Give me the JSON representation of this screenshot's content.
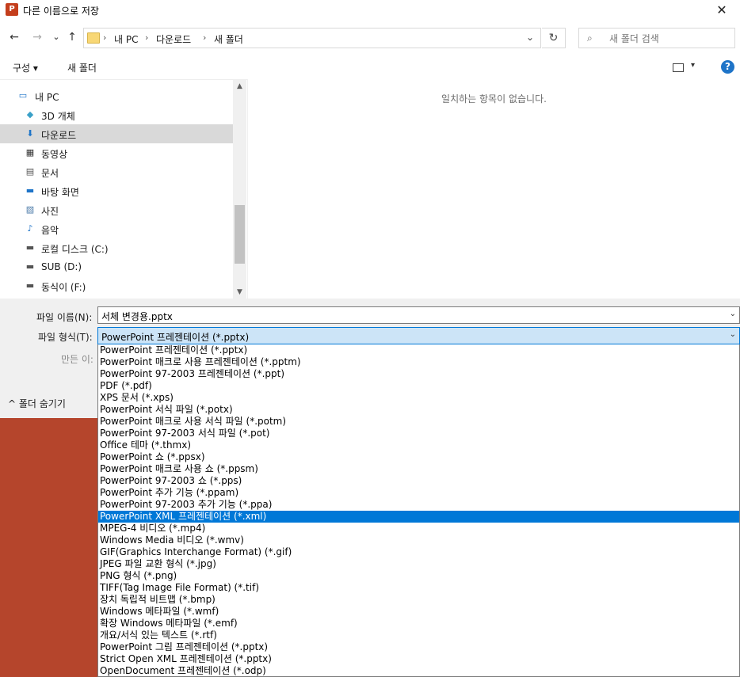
{
  "window": {
    "app_icon": "P",
    "title": "다른 이름으로 저장",
    "close_icon": "✕"
  },
  "nav": {
    "back_icon": "←",
    "forward_icon": "→",
    "recent_icon": "⌄",
    "up_icon": "↑",
    "breadcrumb": [
      "내 PC",
      "다운로드",
      "새 폴더"
    ],
    "separator": "›",
    "address_dropdown_icon": "⌄",
    "refresh_icon": "↻",
    "search_icon": "⌕",
    "search_placeholder": "새 폴더 검색"
  },
  "toolbar": {
    "organize_label": "구성 ▾",
    "new_folder_label": "새 폴더",
    "view_dropdown_icon": "▾",
    "help_icon": "?"
  },
  "tree": {
    "items": [
      {
        "label": "내 PC",
        "icon": "pc-icon",
        "glyph": "▭",
        "color": "#1e74c8"
      },
      {
        "label": "3D 개체",
        "icon": "cube-icon",
        "glyph": "◆",
        "color": "#3aa0c8"
      },
      {
        "label": "다운로드",
        "icon": "download-icon",
        "glyph": "⬇",
        "color": "#1e74c8"
      },
      {
        "label": "동영상",
        "icon": "film-icon",
        "glyph": "▦",
        "color": "#333333"
      },
      {
        "label": "문서",
        "icon": "document-icon",
        "glyph": "▤",
        "color": "#555555"
      },
      {
        "label": "바탕 화면",
        "icon": "desktop-icon",
        "glyph": "▬",
        "color": "#1e74c8"
      },
      {
        "label": "사진",
        "icon": "picture-icon",
        "glyph": "▧",
        "color": "#4a7aa8"
      },
      {
        "label": "음악",
        "icon": "music-icon",
        "glyph": "♪",
        "color": "#1e74c8"
      },
      {
        "label": "로컬 디스크 (C:)",
        "icon": "drive-icon",
        "glyph": "▬",
        "color": "#555555"
      },
      {
        "label": "SUB (D:)",
        "icon": "drive-icon",
        "glyph": "▬",
        "color": "#555555"
      },
      {
        "label": "동식이 (F:)",
        "icon": "drive-icon",
        "glyph": "▬",
        "color": "#555555"
      }
    ],
    "selected_index": 2,
    "scroll_up_icon": "▲",
    "scroll_down_icon": "▼"
  },
  "content": {
    "empty_message": "일치하는 항목이 없습니다."
  },
  "form": {
    "filename_label": "파일 이름(N):",
    "filename_value": "서체 변경용.pptx",
    "filetype_label": "파일 형식(T):",
    "filetype_value": "PowerPoint 프레젠테이션 (*.pptx)",
    "author_label_partial": "만든 이:",
    "dropdown_icon": "⌄",
    "hide_folders_label": "^  폴더 숨기기"
  },
  "filetype_options": [
    "PowerPoint 프레젠테이션 (*.pptx)",
    "PowerPoint 매크로 사용 프레젠테이션 (*.pptm)",
    "PowerPoint 97-2003 프레젠테이션 (*.ppt)",
    "PDF (*.pdf)",
    "XPS 문서 (*.xps)",
    "PowerPoint 서식 파일 (*.potx)",
    "PowerPoint 매크로 사용 서식 파일 (*.potm)",
    "PowerPoint 97-2003 서식 파일 (*.pot)",
    "Office 테마 (*.thmx)",
    "PowerPoint 쇼 (*.ppsx)",
    "PowerPoint 매크로 사용 쇼 (*.ppsm)",
    "PowerPoint 97-2003 쇼 (*.pps)",
    "PowerPoint 추가 기능 (*.ppam)",
    "PowerPoint 97-2003 추가 기능 (*.ppa)",
    "PowerPoint XML 프레젠테이션 (*.xml)",
    "MPEG-4 비디오 (*.mp4)",
    "Windows Media 비디오 (*.wmv)",
    "GIF(Graphics Interchange Format) (*.gif)",
    "JPEG 파일 교환 형식 (*.jpg)",
    "PNG 형식 (*.png)",
    "TIFF(Tag Image File Format) (*.tif)",
    "장치 독립적 비트맵 (*.bmp)",
    "Windows 메타파일 (*.wmf)",
    "확장 Windows 메타파일 (*.emf)",
    "개요/서식 있는 텍스트 (*.rtf)",
    "PowerPoint 그림 프레젠테이션 (*.pptx)",
    "Strict Open XML 프레젠테이션 (*.pptx)",
    "OpenDocument 프레젠테이션 (*.odp)"
  ],
  "highlighted_option_index": 14,
  "colors": {
    "accent": "#0078d7",
    "app_brand": "#c43e1c",
    "background_app": "#b5452c"
  }
}
